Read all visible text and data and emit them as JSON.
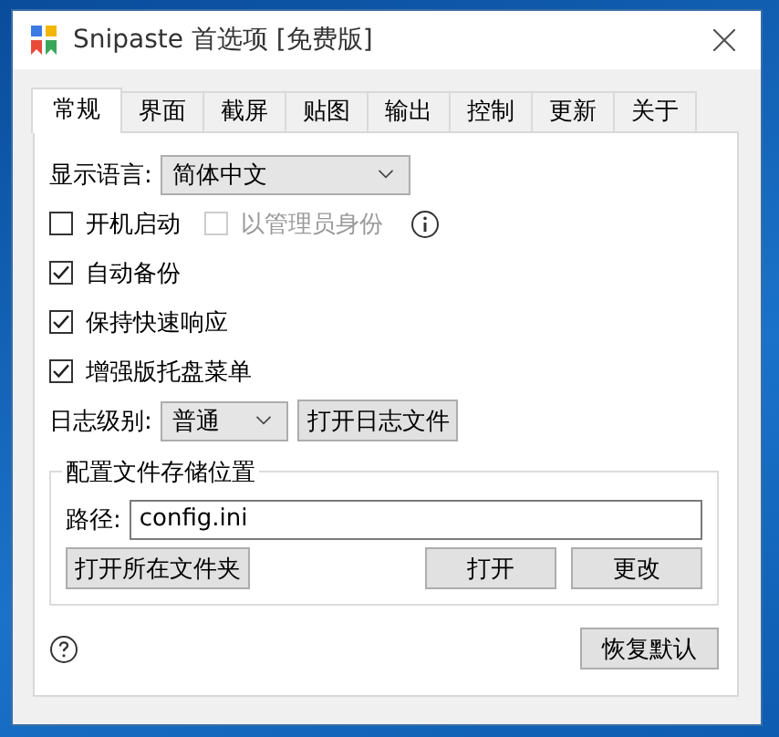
{
  "window": {
    "title": "Snipaste 首选项 [免费版]"
  },
  "tabs": [
    {
      "label": "常规",
      "selected": true
    },
    {
      "label": "界面",
      "selected": false
    },
    {
      "label": "截屏",
      "selected": false
    },
    {
      "label": "贴图",
      "selected": false
    },
    {
      "label": "输出",
      "selected": false
    },
    {
      "label": "控制",
      "selected": false
    },
    {
      "label": "更新",
      "selected": false
    },
    {
      "label": "关于",
      "selected": false
    }
  ],
  "language": {
    "label": "显示语言:",
    "value": "简体中文"
  },
  "startup": [
    {
      "label": "开机启动",
      "checked": false,
      "disabled": false
    },
    {
      "label": "以管理员身份",
      "checked": false,
      "disabled": true
    }
  ],
  "options": [
    {
      "label": "自动备份",
      "checked": true
    },
    {
      "label": "保持快速响应",
      "checked": true
    },
    {
      "label": "增强版托盘菜单",
      "checked": true
    }
  ],
  "log": {
    "label": "日志级别:",
    "value": "普通",
    "button": "打开日志文件"
  },
  "config_group": {
    "title": "配置文件存储位置",
    "path_label": "路径:",
    "path_value": "config.ini",
    "buttons": [
      "打开所在文件夹",
      "打开",
      "更改"
    ]
  },
  "footer": {
    "button": "恢复默认"
  }
}
